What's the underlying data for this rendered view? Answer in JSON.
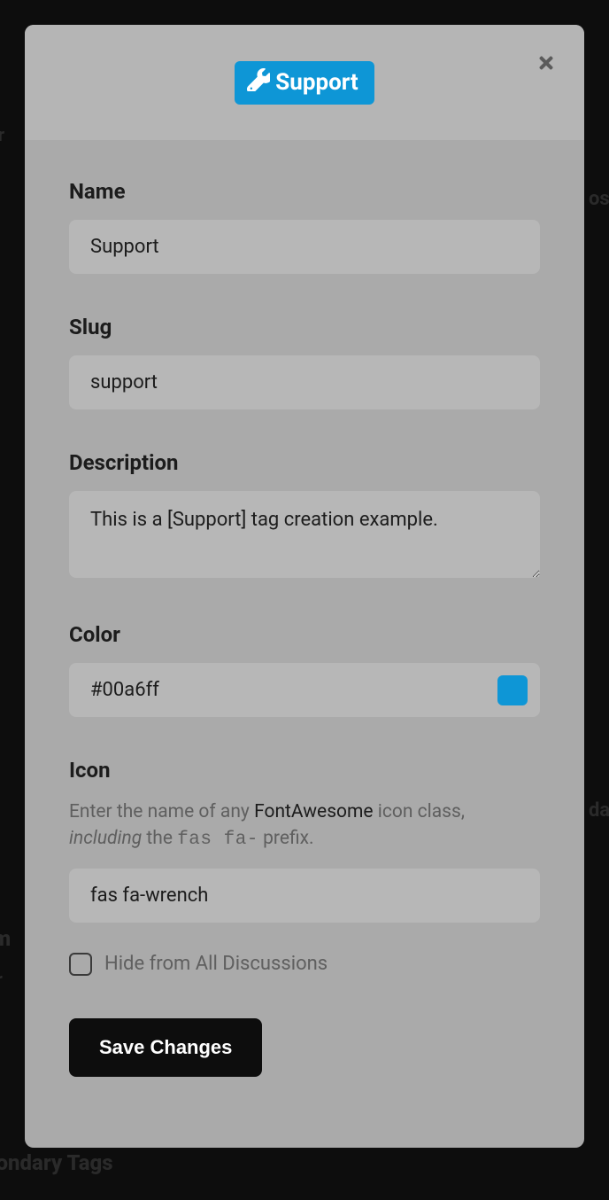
{
  "background": {
    "text1": "rar",
    "text2": "os",
    "text3": "da",
    "text4": "im",
    "text5": "xir",
    "text6": "econdary Tags"
  },
  "modal": {
    "badge": {
      "label": "Support",
      "color": "#0e96d6"
    },
    "fields": {
      "name": {
        "label": "Name",
        "value": "Support"
      },
      "slug": {
        "label": "Slug",
        "value": "support"
      },
      "description": {
        "label": "Description",
        "value": "This is a [Support] tag creation example."
      },
      "color": {
        "label": "Color",
        "value": "#00a6ff",
        "swatch": "#0e96d6"
      },
      "icon": {
        "label": "Icon",
        "help_pre": "Enter the name of any ",
        "help_strong": "FontAwesome",
        "help_mid": " icon class, ",
        "help_ital": "including",
        "help_post1": " the ",
        "help_mono": "fas fa-",
        "help_post2": " prefix.",
        "value": "fas fa-wrench"
      },
      "hide": {
        "label": "Hide from All Discussions",
        "checked": false
      }
    },
    "save_label": "Save Changes"
  }
}
